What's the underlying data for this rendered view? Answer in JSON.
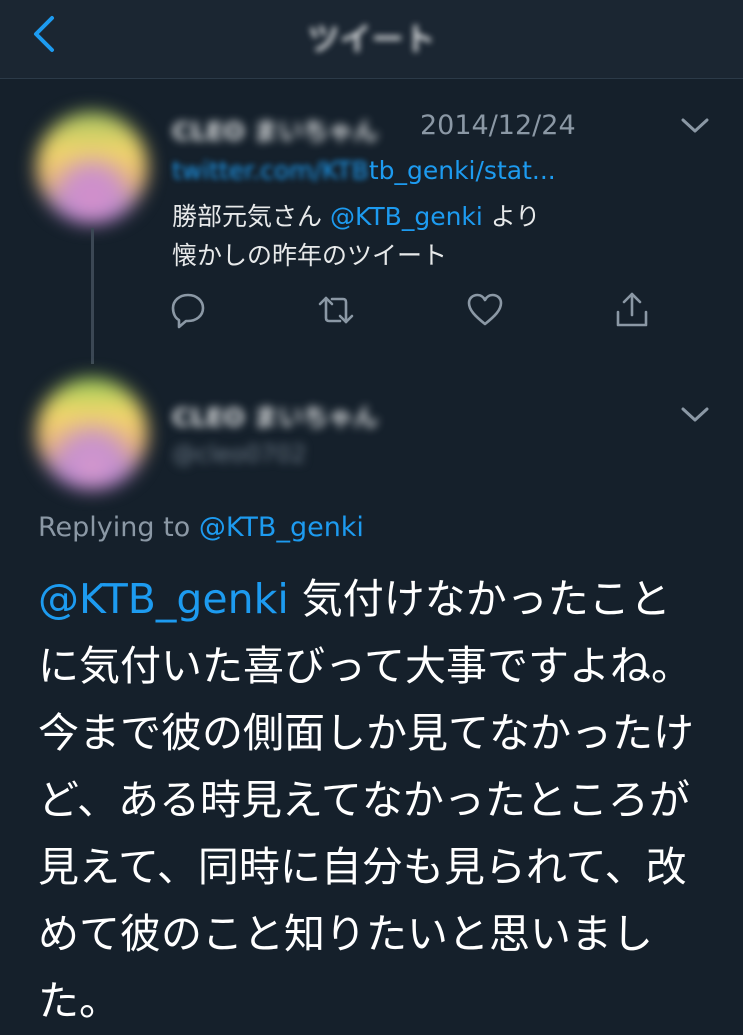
{
  "header": {
    "title": "ツイート"
  },
  "quoted_tweet": {
    "display_name": "CLEO まいちゃん",
    "date": "2014/12/24",
    "link_prefix": "twitter.com/KTB",
    "link_visible": "tb_genki/stat...",
    "text_line1_prefix": "勝部元気さん ",
    "text_line1_mention": "@KTB_genki",
    "text_line1_suffix": " より",
    "text_line2": "懐かしの昨年のツイート",
    "actions": [
      "reply-icon",
      "retweet-icon",
      "like-icon",
      "share-icon"
    ]
  },
  "reply_tweet": {
    "display_name": "CLEO まいちゃん",
    "handle": "@cleo0702",
    "replying_label": "Replying to ",
    "replying_mention": "@KTB_genki",
    "body_mention": "@KTB_genki",
    "body_text": " 気付けなかったことに気付いた喜びって大事ですよね。今まで彼の側面しか見てなかったけど、ある時見えてなかったところが見えて、同時に自分も見られて、改めて彼のこと知りたいと思いました。"
  },
  "colors": {
    "background": "#15202b",
    "accent": "#1d9bf0",
    "secondary_text": "#8b98a5"
  }
}
